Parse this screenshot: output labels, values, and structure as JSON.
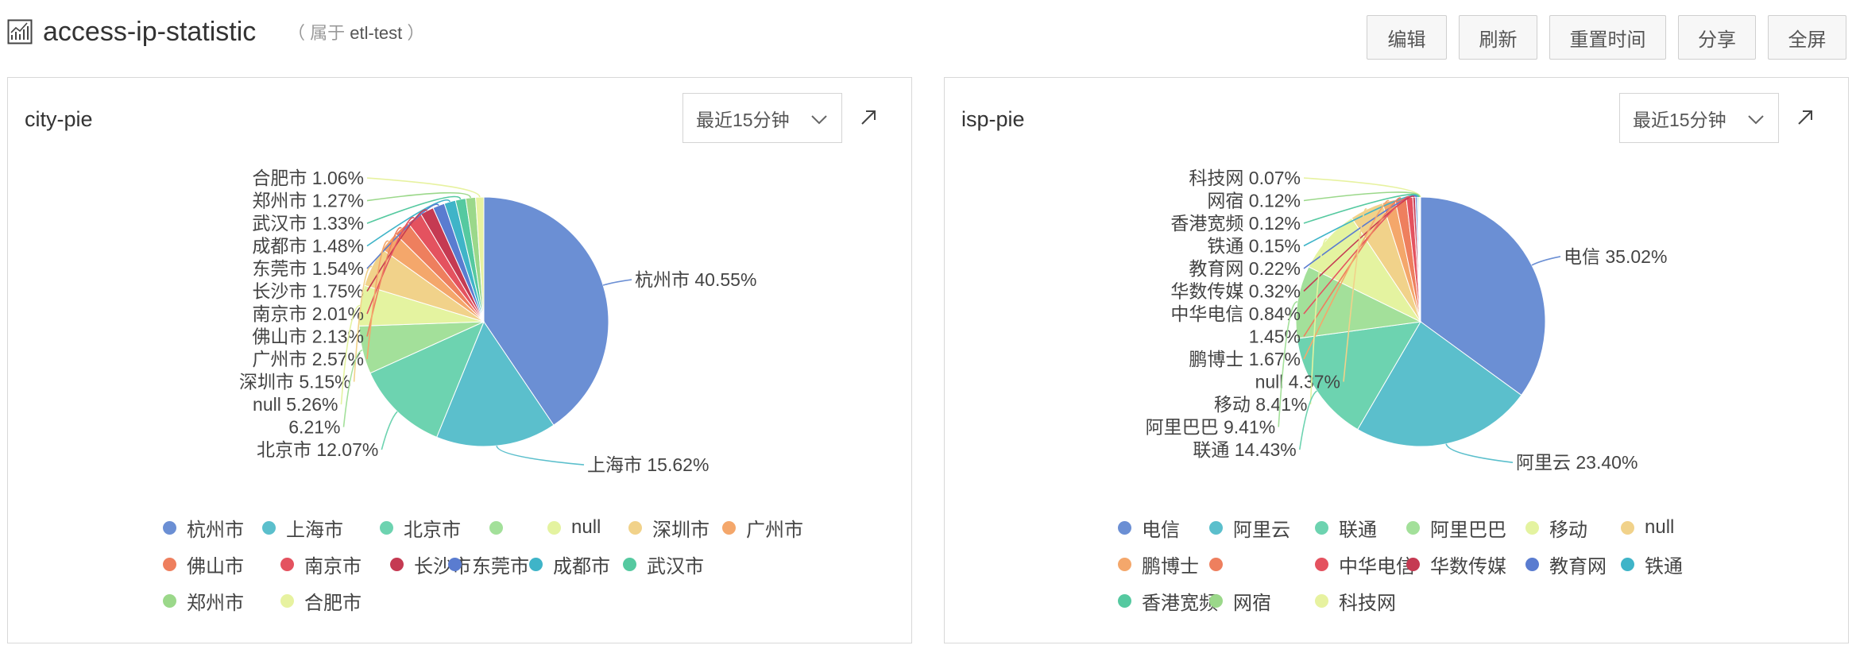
{
  "header": {
    "title": "access-ip-statistic",
    "owner_prefix": "（ 属于 ",
    "owner_name": "etl-test",
    "owner_suffix": " ）",
    "buttons": [
      "编辑",
      "刷新",
      "重置时间",
      "分享",
      "全屏"
    ]
  },
  "panels": [
    {
      "title": "city-pie",
      "time_range": "最近15分钟",
      "expand_icon": "external-arrow-icon"
    },
    {
      "title": "isp-pie",
      "time_range": "最近15分钟",
      "expand_icon": "external-arrow-icon"
    }
  ],
  "chart_data": [
    {
      "type": "pie",
      "title": "city-pie",
      "slices": [
        {
          "name": "杭州市",
          "value": 40.55,
          "label": "杭州市 40.55%",
          "color": "#6b8fd4"
        },
        {
          "name": "上海市",
          "value": 15.62,
          "label": "上海市 15.62%",
          "color": "#5bbfcc"
        },
        {
          "name": "北京市",
          "value": 12.07,
          "label": "北京市 12.07%",
          "color": "#6dd3b0"
        },
        {
          "name": "",
          "value": 6.21,
          "label": "6.21%",
          "color": "#a3e09a"
        },
        {
          "name": "null",
          "value": 5.26,
          "label": "null 5.26%",
          "color": "#e4f3a0"
        },
        {
          "name": "深圳市",
          "value": 5.15,
          "label": "深圳市 5.15%",
          "color": "#f1d28a"
        },
        {
          "name": "广州市",
          "value": 2.57,
          "label": "广州市 2.57%",
          "color": "#f4a76b"
        },
        {
          "name": "佛山市",
          "value": 2.13,
          "label": "佛山市 2.13%",
          "color": "#ee7f5e"
        },
        {
          "name": "南京市",
          "value": 2.01,
          "label": "南京市 2.01%",
          "color": "#e4525f"
        },
        {
          "name": "长沙市",
          "value": 1.75,
          "label": "长沙市 1.75%",
          "color": "#c53a52"
        },
        {
          "name": "东莞市",
          "value": 1.54,
          "label": "东莞市 1.54%",
          "color": "#5a7cd0"
        },
        {
          "name": "成都市",
          "value": 1.48,
          "label": "成都市 1.48%",
          "color": "#3fb4c8"
        },
        {
          "name": "武汉市",
          "value": 1.33,
          "label": "武汉市 1.33%",
          "color": "#55c9a0"
        },
        {
          "name": "郑州市",
          "value": 1.27,
          "label": "郑州市 1.27%",
          "color": "#9bd88a"
        },
        {
          "name": "合肥市",
          "value": 1.06,
          "label": "合肥市 1.06%",
          "color": "#e7f2a0"
        }
      ],
      "legend": [
        "杭州市",
        "上海市",
        "北京市",
        "",
        "null",
        "深圳市",
        "广州市",
        "佛山市",
        "南京市",
        "长沙市",
        "东莞市",
        "成都市",
        "武汉市",
        "郑州市",
        "合肥市"
      ]
    },
    {
      "type": "pie",
      "title": "isp-pie",
      "slices": [
        {
          "name": "电信",
          "value": 35.02,
          "label": "电信 35.02%",
          "color": "#6b8fd4"
        },
        {
          "name": "阿里云",
          "value": 23.4,
          "label": "阿里云 23.40%",
          "color": "#5bbfcc"
        },
        {
          "name": "联通",
          "value": 14.43,
          "label": "联通 14.43%",
          "color": "#6dd3b0"
        },
        {
          "name": "阿里巴巴",
          "value": 9.41,
          "label": "阿里巴巴 9.41%",
          "color": "#a3e09a"
        },
        {
          "name": "移动",
          "value": 8.41,
          "label": "移动 8.41%",
          "color": "#e4f3a0"
        },
        {
          "name": "null",
          "value": 4.37,
          "label": "null 4.37%",
          "color": "#f1d28a"
        },
        {
          "name": "鹏博士",
          "value": 1.67,
          "label": "鹏博士 1.67%",
          "color": "#f4a76b"
        },
        {
          "name": "",
          "value": 1.45,
          "label": "1.45%",
          "color": "#ee7f5e"
        },
        {
          "name": "中华电信",
          "value": 0.84,
          "label": "中华电信 0.84%",
          "color": "#e4525f"
        },
        {
          "name": "华数传媒",
          "value": 0.32,
          "label": "华数传媒 0.32%",
          "color": "#c53a52"
        },
        {
          "name": "教育网",
          "value": 0.22,
          "label": "教育网 0.22%",
          "color": "#5a7cd0"
        },
        {
          "name": "铁通",
          "value": 0.15,
          "label": "铁通 0.15%",
          "color": "#3fb4c8"
        },
        {
          "name": "香港宽频",
          "value": 0.12,
          "label": "香港宽频 0.12%",
          "color": "#55c9a0"
        },
        {
          "name": "网宿",
          "value": 0.12,
          "label": "网宿 0.12%",
          "color": "#9bd88a"
        },
        {
          "name": "科技网",
          "value": 0.07,
          "label": "科技网 0.07%",
          "color": "#e7f2a0"
        }
      ],
      "legend": [
        "电信",
        "阿里云",
        "联通",
        "阿里巴巴",
        "移动",
        "null",
        "鹏博士",
        "",
        "中华电信",
        "华数传媒",
        "教育网",
        "铁通",
        "香港宽频",
        "网宿",
        "科技网"
      ]
    }
  ]
}
